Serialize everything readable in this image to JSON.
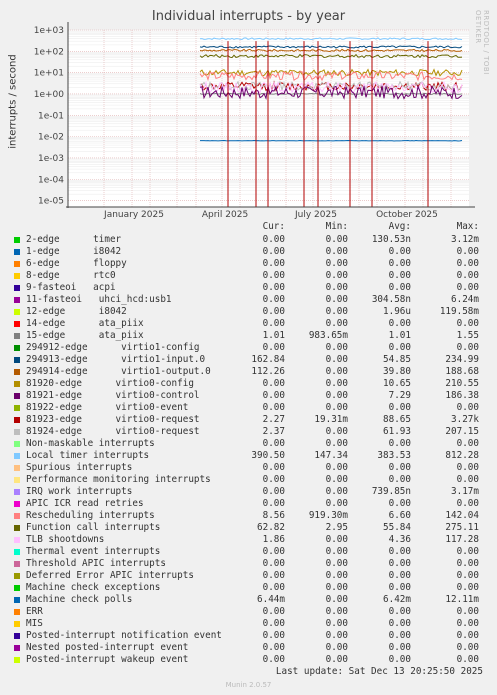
{
  "title": "Individual interrupts - by year",
  "side_label": "RRDTOOL / TOBI OETIKER",
  "footer": "Last update: Sat Dec 13 20:25:50 2025",
  "munin": "Munin 2.0.57",
  "chart_data": {
    "type": "line",
    "title": "Individual interrupts - by year",
    "ylabel": "interrupts / second",
    "yscale": "log",
    "ylim": [
      5e-06,
      1000
    ],
    "yticks": [
      "1e+03",
      "1e+02",
      "1e+01",
      "1e+00",
      "1e-01",
      "1e-02",
      "1e-03",
      "1e-04",
      "1e-05"
    ],
    "xticks": [
      "January 2025",
      "April 2025",
      "July 2025",
      "October 2025"
    ],
    "grid": true
  },
  "legend": {
    "headers": [
      "Cur:",
      "Min:",
      "Avg:",
      "Max:"
    ],
    "rows": [
      {
        "name": "2-edge      timer",
        "color": "#00cc00",
        "cur": "0.00",
        "min": "0.00",
        "avg": "130.53n",
        "max": "3.12m"
      },
      {
        "name": "1-edge      i8042",
        "color": "#0066b3",
        "cur": "0.00",
        "min": "0.00",
        "avg": "0.00",
        "max": "0.00"
      },
      {
        "name": "6-edge      floppy",
        "color": "#ff8000",
        "cur": "0.00",
        "min": "0.00",
        "avg": "0.00",
        "max": "0.00"
      },
      {
        "name": "8-edge      rtc0",
        "color": "#ffcc00",
        "cur": "0.00",
        "min": "0.00",
        "avg": "0.00",
        "max": "0.00"
      },
      {
        "name": "9-fasteoi   acpi",
        "color": "#330099",
        "cur": "0.00",
        "min": "0.00",
        "avg": "0.00",
        "max": "0.00"
      },
      {
        "name": "11-fasteoi   uhci_hcd:usb1",
        "color": "#990099",
        "cur": "0.00",
        "min": "0.00",
        "avg": "304.58n",
        "max": "6.24m"
      },
      {
        "name": "12-edge      i8042",
        "color": "#ccff00",
        "cur": "0.00",
        "min": "0.00",
        "avg": "1.96u",
        "max": "119.58m"
      },
      {
        "name": "14-edge      ata_piix",
        "color": "#ff0000",
        "cur": "0.00",
        "min": "0.00",
        "avg": "0.00",
        "max": "0.00"
      },
      {
        "name": "15-edge      ata_piix",
        "color": "#808080",
        "cur": "1.01",
        "min": "983.65m",
        "avg": "1.01",
        "max": "1.55"
      },
      {
        "name": "294912-edge      virtio1-config",
        "color": "#008f00",
        "cur": "0.00",
        "min": "0.00",
        "avg": "0.00",
        "max": "0.00"
      },
      {
        "name": "294913-edge      virtio1-input.0",
        "color": "#00487d",
        "cur": "162.84",
        "min": "0.00",
        "avg": "54.85",
        "max": "234.99"
      },
      {
        "name": "294914-edge      virtio1-output.0",
        "color": "#b35a00",
        "cur": "112.26",
        "min": "0.00",
        "avg": "39.80",
        "max": "188.68"
      },
      {
        "name": "81920-edge      virtio0-config",
        "color": "#b38f00",
        "cur": "0.00",
        "min": "0.00",
        "avg": "10.65",
        "max": "210.55"
      },
      {
        "name": "81921-edge      virtio0-control",
        "color": "#6b006b",
        "cur": "0.00",
        "min": "0.00",
        "avg": "7.29",
        "max": "186.38"
      },
      {
        "name": "81922-edge      virtio0-event",
        "color": "#8fb300",
        "cur": "0.00",
        "min": "0.00",
        "avg": "0.00",
        "max": "0.00"
      },
      {
        "name": "81923-edge      virtio0-request",
        "color": "#b30000",
        "cur": "2.27",
        "min": "19.31m",
        "avg": "88.65",
        "max": "3.27k"
      },
      {
        "name": "81924-edge      virtio0-request",
        "color": "#bebebe",
        "cur": "2.37",
        "min": "0.00",
        "avg": "61.93",
        "max": "207.15"
      },
      {
        "name": "Non-maskable interrupts",
        "color": "#80ff80",
        "cur": "0.00",
        "min": "0.00",
        "avg": "0.00",
        "max": "0.00"
      },
      {
        "name": "Local timer interrupts",
        "color": "#80c9ff",
        "cur": "390.50",
        "min": "147.34",
        "avg": "383.53",
        "max": "812.28"
      },
      {
        "name": "Spurious interrupts",
        "color": "#ffc080",
        "cur": "0.00",
        "min": "0.00",
        "avg": "0.00",
        "max": "0.00"
      },
      {
        "name": "Performance monitoring interrupts",
        "color": "#ffe680",
        "cur": "0.00",
        "min": "0.00",
        "avg": "0.00",
        "max": "0.00"
      },
      {
        "name": "IRQ work interrupts",
        "color": "#aa80ff",
        "cur": "0.00",
        "min": "0.00",
        "avg": "739.85n",
        "max": "3.17m"
      },
      {
        "name": "APIC ICR read retries",
        "color": "#ee00cc",
        "cur": "0.00",
        "min": "0.00",
        "avg": "0.00",
        "max": "0.00"
      },
      {
        "name": "Rescheduling interrupts",
        "color": "#ff8080",
        "cur": "8.56",
        "min": "919.30m",
        "avg": "6.60",
        "max": "142.04"
      },
      {
        "name": "Function call interrupts",
        "color": "#666600",
        "cur": "62.82",
        "min": "2.95",
        "avg": "55.84",
        "max": "275.11"
      },
      {
        "name": "TLB shootdowns",
        "color": "#ffbfff",
        "cur": "1.86",
        "min": "0.00",
        "avg": "4.36",
        "max": "117.28"
      },
      {
        "name": "Thermal event interrupts",
        "color": "#00ffcc",
        "cur": "0.00",
        "min": "0.00",
        "avg": "0.00",
        "max": "0.00"
      },
      {
        "name": "Threshold APIC interrupts",
        "color": "#cc6699",
        "cur": "0.00",
        "min": "0.00",
        "avg": "0.00",
        "max": "0.00"
      },
      {
        "name": "Deferred Error APIC interrupts",
        "color": "#999900",
        "cur": "0.00",
        "min": "0.00",
        "avg": "0.00",
        "max": "0.00"
      },
      {
        "name": "Machine check exceptions",
        "color": "#00cc00",
        "cur": "0.00",
        "min": "0.00",
        "avg": "0.00",
        "max": "0.00"
      },
      {
        "name": "Machine check polls",
        "color": "#0066b3",
        "cur": "6.44m",
        "min": "0.00",
        "avg": "6.42m",
        "max": "12.11m"
      },
      {
        "name": "ERR",
        "color": "#ff8000",
        "cur": "0.00",
        "min": "0.00",
        "avg": "0.00",
        "max": "0.00"
      },
      {
        "name": "MIS",
        "color": "#ffcc00",
        "cur": "0.00",
        "min": "0.00",
        "avg": "0.00",
        "max": "0.00"
      },
      {
        "name": "Posted-interrupt notification event",
        "color": "#330099",
        "cur": "0.00",
        "min": "0.00",
        "avg": "0.00",
        "max": "0.00"
      },
      {
        "name": "Nested posted-interrupt event",
        "color": "#990099",
        "cur": "0.00",
        "min": "0.00",
        "avg": "0.00",
        "max": "0.00"
      },
      {
        "name": "Posted-interrupt wakeup event",
        "color": "#ccff00",
        "cur": "0.00",
        "min": "0.00",
        "avg": "0.00",
        "max": "0.00"
      }
    ]
  }
}
